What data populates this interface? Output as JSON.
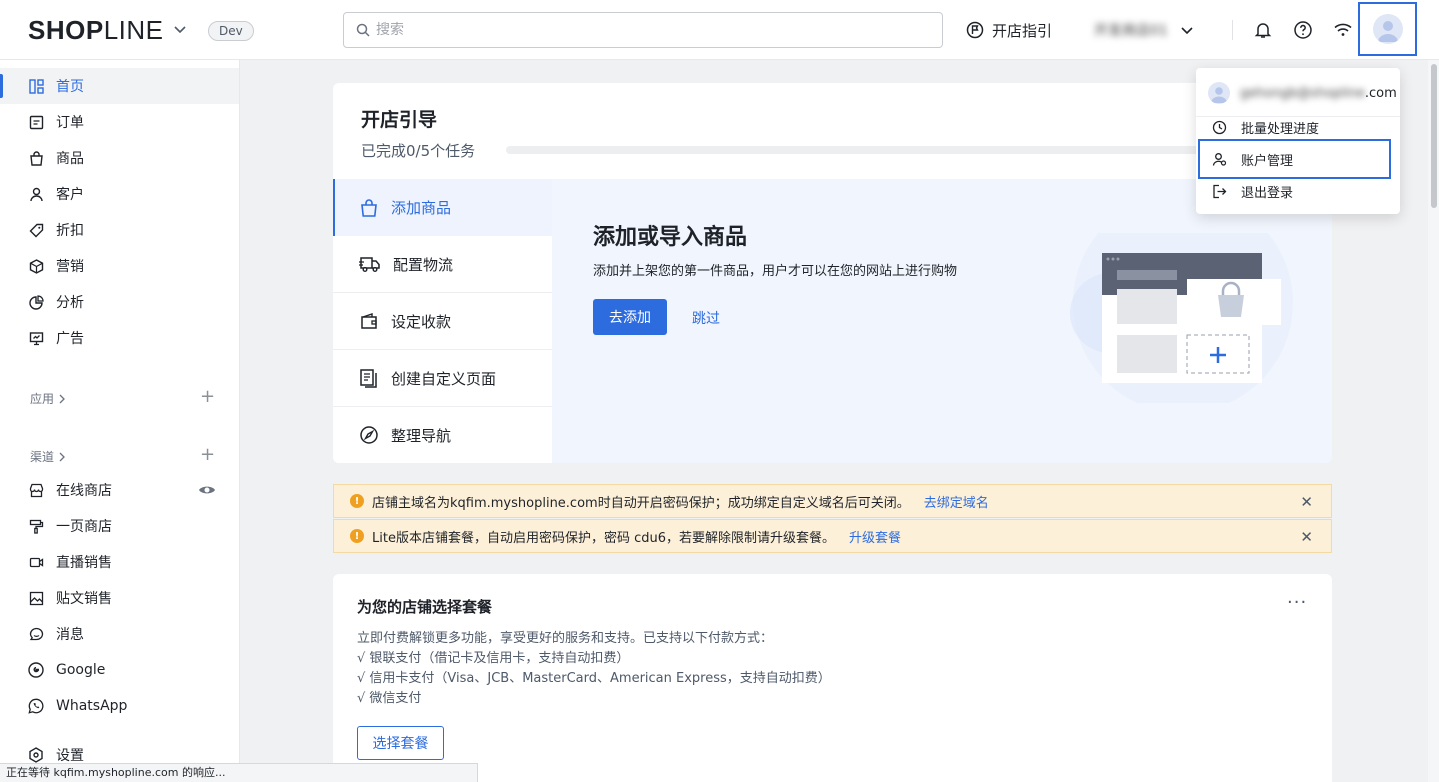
{
  "topbar": {
    "logo_bold_left": "SHOP",
    "logo_thin": "LINE",
    "env_badge": "Dev",
    "search_placeholder": "搜索",
    "guide_label": "开店指引",
    "store_name": "开发商店01"
  },
  "sidebar": {
    "items": [
      {
        "label": "首页",
        "icon": "home-grid-icon"
      },
      {
        "label": "订单",
        "icon": "order-icon"
      },
      {
        "label": "商品",
        "icon": "bag-icon"
      },
      {
        "label": "客户",
        "icon": "user-icon"
      },
      {
        "label": "折扣",
        "icon": "tag-icon"
      },
      {
        "label": "营销",
        "icon": "cube-icon"
      },
      {
        "label": "分析",
        "icon": "pie-chart-icon"
      },
      {
        "label": "广告",
        "icon": "monitor-icon"
      }
    ],
    "apps_label": "应用",
    "channels_label": "渠道",
    "channels": [
      {
        "label": "在线商店",
        "icon": "storefront-icon"
      },
      {
        "label": "一页商店",
        "icon": "brush-icon"
      },
      {
        "label": "直播销售",
        "icon": "video-icon"
      },
      {
        "label": "贴文销售",
        "icon": "image-icon"
      },
      {
        "label": "消息",
        "icon": "chat-icon"
      },
      {
        "label": "Google",
        "icon": "google-icon"
      },
      {
        "label": "WhatsApp",
        "icon": "whatsapp-icon"
      }
    ],
    "settings_label": "设置"
  },
  "guide": {
    "title": "开店引导",
    "progress_text": "已完成0/5个任务",
    "progress_fraction": 0,
    "tasks": [
      {
        "label": "添加商品",
        "icon": "bag-icon"
      },
      {
        "label": "配置物流",
        "icon": "truck-icon"
      },
      {
        "label": "设定收款",
        "icon": "wallet-icon"
      },
      {
        "label": "创建自定义页面",
        "icon": "pages-icon"
      },
      {
        "label": "整理导航",
        "icon": "compass-icon"
      }
    ],
    "detail_title": "添加或导入商品",
    "detail_desc": "添加并上架您的第一件商品，用户才可以在您的网站上进行购物",
    "primary_button": "去添加",
    "skip_link": "跳过"
  },
  "alerts": [
    {
      "text": "店铺主域名为kqfim.myshopline.com时自动开启密码保护；成功绑定自定义域名后可关闭。",
      "link": "去绑定域名"
    },
    {
      "text": "Lite版本店铺套餐，自动启用密码保护，密码 cdu6，若要解除限制请升级套餐。",
      "link": "升级套餐"
    }
  ],
  "plan": {
    "title": "为您的店铺选择套餐",
    "more": "···",
    "lines": [
      "立即付费解锁更多功能，享受更好的服务和支持。已支持以下付款方式：",
      "√ 银联支付（借记卡及信用卡，支持自动扣费）",
      "√ 信用卡支付（Visa、JCB、MasterCard、American Express，支持自动扣费）",
      "√ 微信支付"
    ],
    "button": "选择套餐"
  },
  "dropdown": {
    "email_hidden": "gehongb@shopline",
    "email_suffix": ".com",
    "items": [
      {
        "label": "批量处理进度",
        "icon": "clock-icon"
      },
      {
        "label": "账户管理",
        "icon": "account-settings-icon"
      },
      {
        "label": "退出登录",
        "icon": "logout-icon"
      }
    ]
  },
  "statusbar": {
    "text": "正在等待 kqfim.myshopline.com 的响应..."
  },
  "colors": {
    "accent": "#2d6cdf",
    "warning_bg": "#fdf0d8",
    "warning_icon": "#f0a020"
  }
}
